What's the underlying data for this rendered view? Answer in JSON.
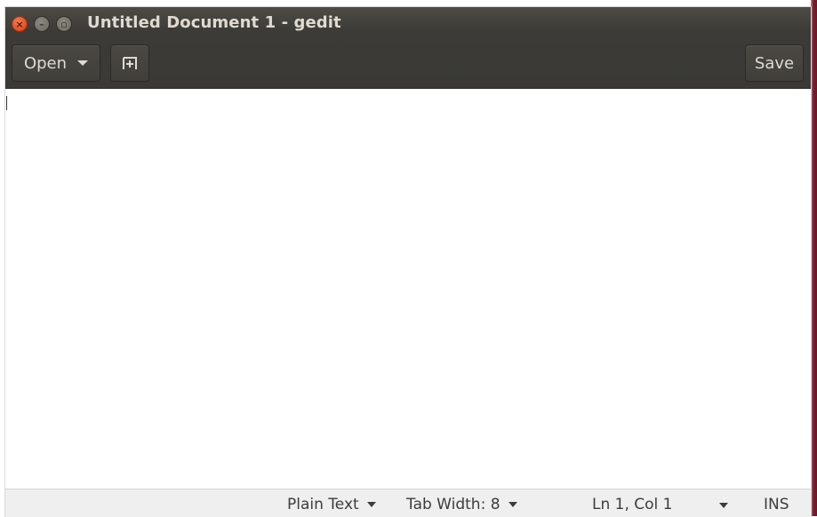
{
  "window": {
    "title": "Untitled Document 1 - gedit",
    "controls": {
      "close_glyph": "×",
      "minimize_glyph": "–",
      "maximize_glyph": "▫"
    }
  },
  "toolbar": {
    "open_label": "Open",
    "new_tab_icon": "new-tab-icon",
    "save_label": "Save"
  },
  "editor": {
    "content": ""
  },
  "statusbar": {
    "language": "Plain Text",
    "tab_width": "Tab Width: 8",
    "position": "Ln 1, Col 1",
    "mode": "INS"
  },
  "colors": {
    "headerbar": "#3c3b37",
    "close_button": "#e4542b",
    "window_edge": "#6a1728"
  }
}
